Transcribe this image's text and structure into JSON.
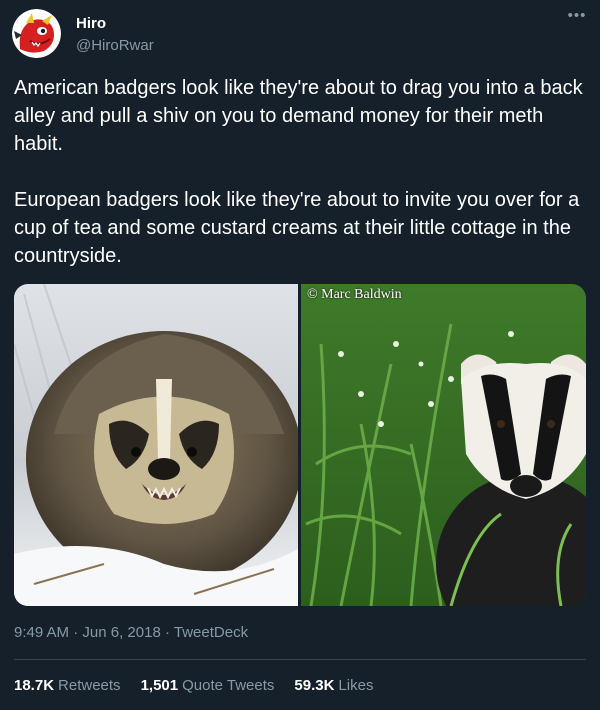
{
  "author": {
    "name": "Hiro",
    "handle": "@HiroRwar",
    "avatar_icon": "red-dragon-avatar"
  },
  "more_icon": "ellipsis-icon",
  "tweet": {
    "paragraphs": [
      "American badgers look like they're about to drag you into a back alley and pull a shiv on you to demand money for their meth habit.",
      "European badgers look like they're about to invite you over for a cup of tea and some custard creams at their little cottage in the countryside."
    ]
  },
  "media": {
    "left_photo": "american-badger-in-snow",
    "right_photo": "european-badger-in-grass",
    "watermark": "© Marc Baldwin"
  },
  "meta": {
    "time": "9:49 AM",
    "date": "Jun 6, 2018",
    "source": "TweetDeck",
    "separator": "·"
  },
  "stats": {
    "retweets_count": "18.7K",
    "retweets_label": "Retweets",
    "quotes_count": "1,501",
    "quotes_label": "Quote Tweets",
    "likes_count": "59.3K",
    "likes_label": "Likes"
  },
  "colors": {
    "background": "#15202b",
    "primary_text": "#ffffff",
    "secondary_text": "#8899a6",
    "divider": "#38444d"
  }
}
